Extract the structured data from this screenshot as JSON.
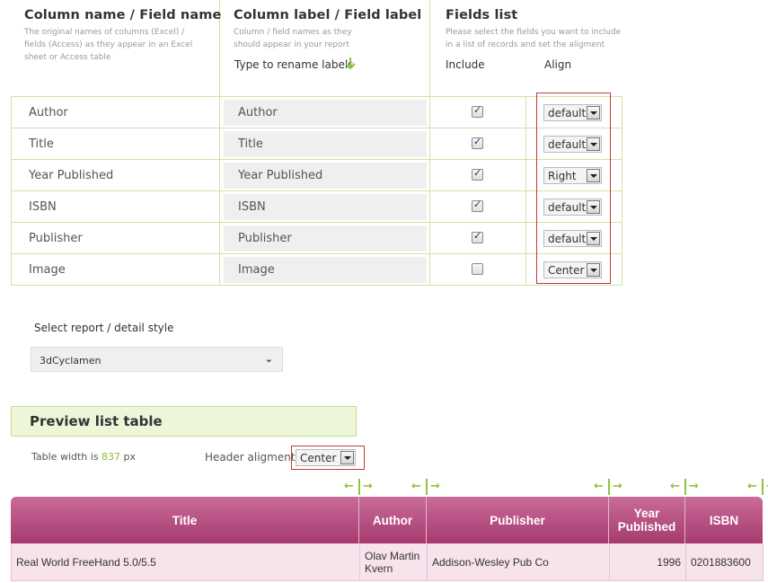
{
  "headers": {
    "col1_title": "Column name / Field name",
    "col1_desc": "The original names of columns (Excel) / fields (Access) as they appear in an Excel sheet or Access table",
    "col2_title": "Column label / Field label",
    "col2_desc": "Column / field names as they should appear in your report",
    "col2_hint": "Type to rename labels",
    "col3_title": "Fields list",
    "col3_desc": "Please select the fields you want to include in a list of records and set the aligment",
    "include_label": "Include",
    "align_label": "Align"
  },
  "fields": [
    {
      "name": "Author",
      "label": "Author",
      "include": true,
      "align": "default"
    },
    {
      "name": "Title",
      "label": "Title",
      "include": true,
      "align": "default"
    },
    {
      "name": "Year Published",
      "label": "Year Published",
      "include": true,
      "align": "Right"
    },
    {
      "name": "ISBN",
      "label": "ISBN",
      "include": true,
      "align": "default"
    },
    {
      "name": "Publisher",
      "label": "Publisher",
      "include": true,
      "align": "default"
    },
    {
      "name": "Image",
      "label": "Image",
      "include": false,
      "align": "Center"
    }
  ],
  "report_style": {
    "label": "Select report / detail style",
    "value": "3dCyclamen"
  },
  "preview": {
    "title": "Preview list table",
    "width_prefix": "Table width is",
    "width_value": "837",
    "width_unit": "px",
    "header_alignment_label": "Header aligment",
    "header_alignment_value": "Center",
    "columns": [
      "Title",
      "Author",
      "Publisher",
      "Year\nPublished",
      "ISBN"
    ],
    "rows": [
      [
        "Real World FreeHand 5.0/5.5",
        "Olav Martin Kvern",
        "Addison-Wesley Pub Co",
        "1996",
        "0201883600"
      ]
    ]
  },
  "colors": {
    "accent_green": "#8cc63f",
    "header_magenta": "#b24a7e",
    "highlight_red": "#c0393b"
  },
  "icons": {
    "down_arrow": "arrow-down-icon",
    "resize": "resize-handle-icon",
    "dropdown": "dropdown-arrow-icon"
  }
}
